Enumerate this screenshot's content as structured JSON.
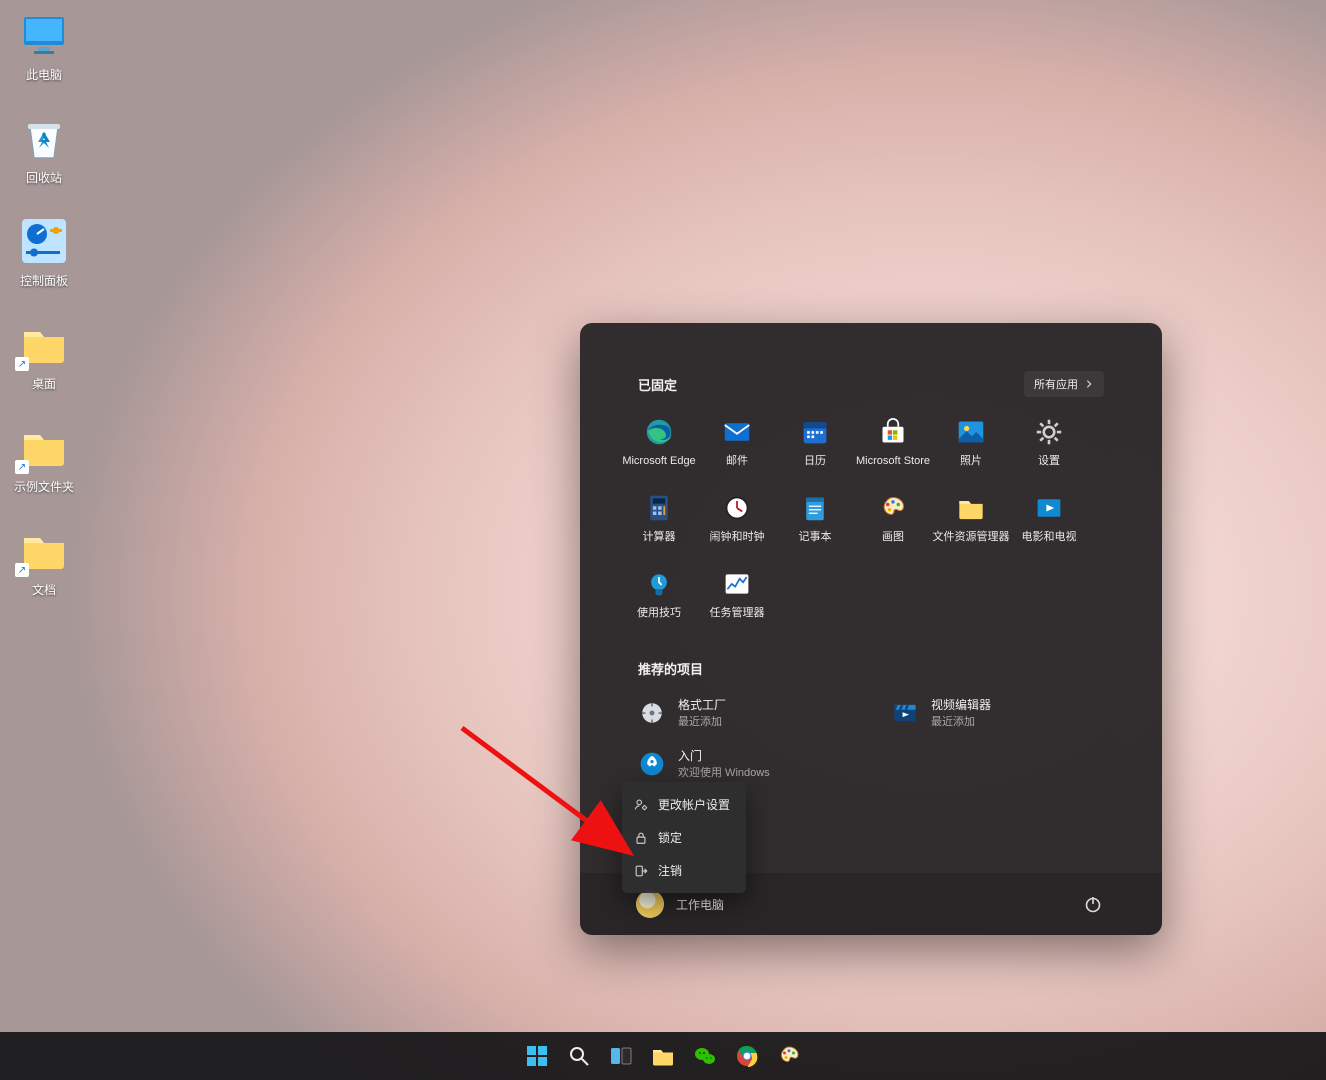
{
  "desktop": {
    "icons": [
      {
        "id": "this-pc",
        "label": "此电脑",
        "kind": "thispc",
        "shortcut": false
      },
      {
        "id": "recycle-bin",
        "label": "回收站",
        "kind": "recyclebin",
        "shortcut": false
      },
      {
        "id": "control-panel",
        "label": "控制面板",
        "kind": "controlpanel",
        "shortcut": false
      },
      {
        "id": "desktop-fold",
        "label": "桌面",
        "kind": "folder",
        "shortcut": true
      },
      {
        "id": "sample-fold",
        "label": "示例文件夹",
        "kind": "folder",
        "shortcut": true
      },
      {
        "id": "docs-fold",
        "label": "文档",
        "kind": "folder",
        "shortcut": true
      }
    ]
  },
  "start": {
    "pinned_title": "已固定",
    "all_apps_label": "所有应用",
    "pinned": [
      {
        "id": "edge",
        "label": "Microsoft Edge",
        "icon": "edge"
      },
      {
        "id": "mail",
        "label": "邮件",
        "icon": "mail"
      },
      {
        "id": "calendar",
        "label": "日历",
        "icon": "calendar"
      },
      {
        "id": "store",
        "label": "Microsoft Store",
        "icon": "store"
      },
      {
        "id": "photos",
        "label": "照片",
        "icon": "photos"
      },
      {
        "id": "settings",
        "label": "设置",
        "icon": "gear"
      },
      {
        "id": "calc",
        "label": "计算器",
        "icon": "calculator"
      },
      {
        "id": "clock",
        "label": "闹钟和时钟",
        "icon": "clock"
      },
      {
        "id": "notepad",
        "label": "记事本",
        "icon": "notepad"
      },
      {
        "id": "paint",
        "label": "画图",
        "icon": "paint"
      },
      {
        "id": "explorer",
        "label": "文件资源管理器",
        "icon": "folder"
      },
      {
        "id": "movies",
        "label": "电影和电视",
        "icon": "movies"
      },
      {
        "id": "tips",
        "label": "使用技巧",
        "icon": "bulb"
      },
      {
        "id": "taskmgr",
        "label": "任务管理器",
        "icon": "taskmgr"
      }
    ],
    "recommended_title": "推荐的项目",
    "recommended": [
      {
        "id": "formatfactory",
        "name": "格式工厂",
        "sub": "最近添加",
        "icon": "gear-cd"
      },
      {
        "id": "videoeditor",
        "name": "视频编辑器",
        "sub": "最近添加",
        "icon": "clapper"
      },
      {
        "id": "getstarted",
        "name": "入门",
        "sub": "欢迎使用 Windows",
        "icon": "rocket"
      }
    ],
    "user_name": "工作电脑",
    "user_menu": {
      "change_account": "更改帐户设置",
      "lock": "锁定",
      "sign_out": "注销"
    }
  },
  "taskbar": {
    "items": [
      {
        "id": "start",
        "icon": "winlogo"
      },
      {
        "id": "search",
        "icon": "magnify"
      },
      {
        "id": "taskview",
        "icon": "taskview"
      },
      {
        "id": "explorer",
        "icon": "folder"
      },
      {
        "id": "wechat",
        "icon": "wechat"
      },
      {
        "id": "chrome",
        "icon": "chrome"
      },
      {
        "id": "paint",
        "icon": "paint"
      }
    ]
  }
}
